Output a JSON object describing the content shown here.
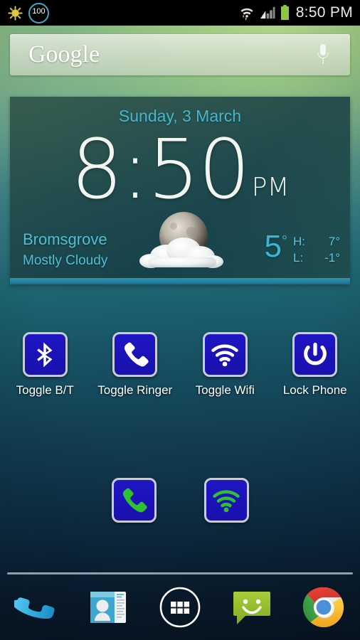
{
  "statusbar": {
    "notification_icon": "sun-icon",
    "battery_percent": "100",
    "wifi_icon": "wifi-data-icon",
    "signal_icon": "cellular-signal-icon",
    "battery_icon": "battery-full-icon",
    "time": "8:50 PM"
  },
  "search": {
    "logo_text": "Google",
    "mic_icon": "microphone-icon"
  },
  "clock_widget": {
    "date": "Sunday, 3 March",
    "time": "8:50",
    "ampm": "PM",
    "city": "Bromsgrove",
    "condition": "Mostly Cloudy",
    "weather_icon": "moon-behind-cloud-icon",
    "temperature": "5",
    "degree_symbol": "°",
    "high_label": "H:",
    "high_value": "7°",
    "low_label": "L:",
    "low_value": "-1°",
    "accent_color": "#3bb4d6",
    "bar_color": "#2682a0"
  },
  "shortcuts_row_1": [
    {
      "label": "Toggle B/T",
      "icon": "bluetooth-icon",
      "icon_color": "#ffffff"
    },
    {
      "label": "Toggle Ringer",
      "icon": "phone-icon",
      "icon_color": "#ffffff"
    },
    {
      "label": "Toggle Wifi",
      "icon": "wifi-icon",
      "icon_color": "#ffffff"
    },
    {
      "label": "Lock Phone",
      "icon": "power-icon",
      "icon_color": "#ffffff"
    }
  ],
  "shortcuts_row_2": [
    {
      "label": "",
      "icon": "phone-icon",
      "icon_color": "#2fc22f"
    },
    {
      "label": "",
      "icon": "wifi-icon",
      "icon_color": "#2fc22f"
    }
  ],
  "dock": [
    {
      "icon": "phone-dialer-icon"
    },
    {
      "icon": "contacts-icon"
    },
    {
      "icon": "app-drawer-icon"
    },
    {
      "icon": "messaging-icon"
    },
    {
      "icon": "chrome-browser-icon"
    }
  ]
}
